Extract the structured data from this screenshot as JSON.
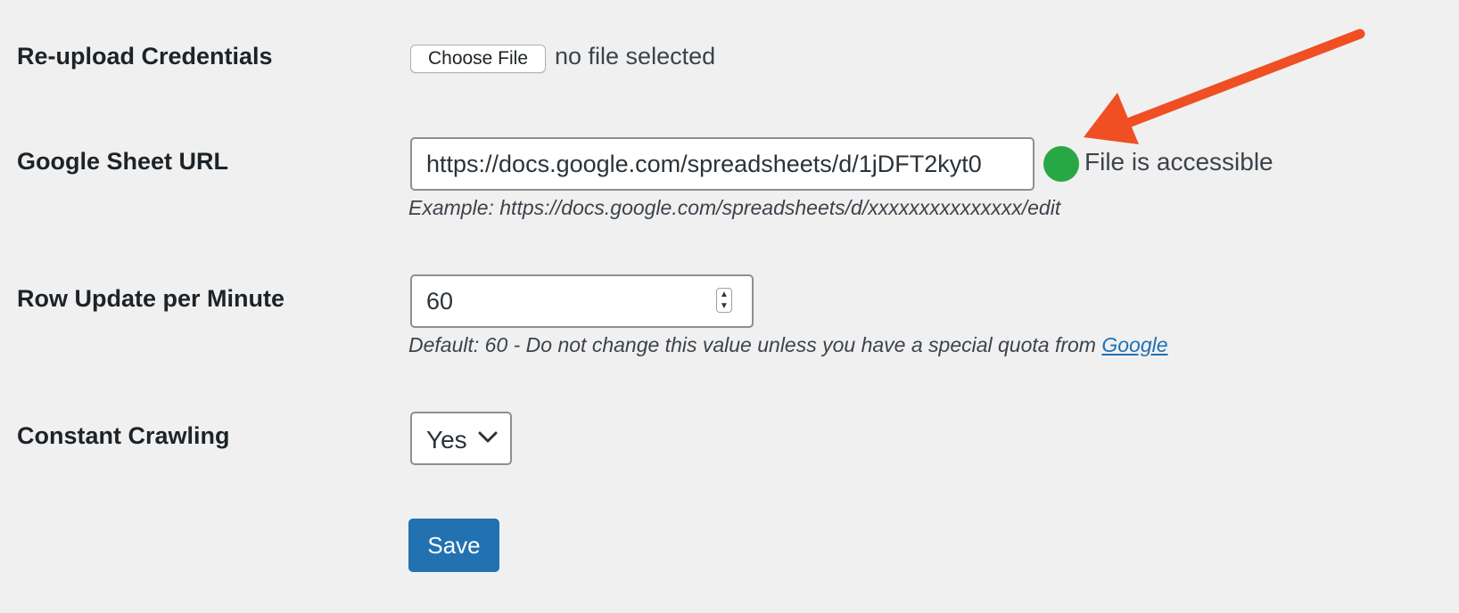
{
  "fields": {
    "credentials": {
      "label": "Re-upload Credentials",
      "button_label": "Choose File",
      "file_status": "no file selected"
    },
    "sheet_url": {
      "label": "Google Sheet URL",
      "value": "https://docs.google.com/spreadsheets/d/1jDFT2kyt0",
      "status_text": "File is accessible",
      "status_color": "#28a745",
      "hint": "Example: https://docs.google.com/spreadsheets/d/xxxxxxxxxxxxxxx/edit"
    },
    "row_update": {
      "label": "Row Update per Minute",
      "value": "60",
      "hint_prefix": "Default: 60 - Do not change this value unless you have a special quota from ",
      "hint_link": "Google"
    },
    "crawling": {
      "label": "Constant Crawling",
      "selected": "Yes"
    }
  },
  "actions": {
    "save_label": "Save"
  },
  "colors": {
    "accent": "#2271b1",
    "annotation_arrow": "#f04e23",
    "background": "#f0f0f1"
  },
  "icons": {
    "arrow": "annotation-arrow-icon",
    "status": "status-dot-icon",
    "chevron": "chevron-down-icon",
    "stepper": "stepper-icon"
  }
}
